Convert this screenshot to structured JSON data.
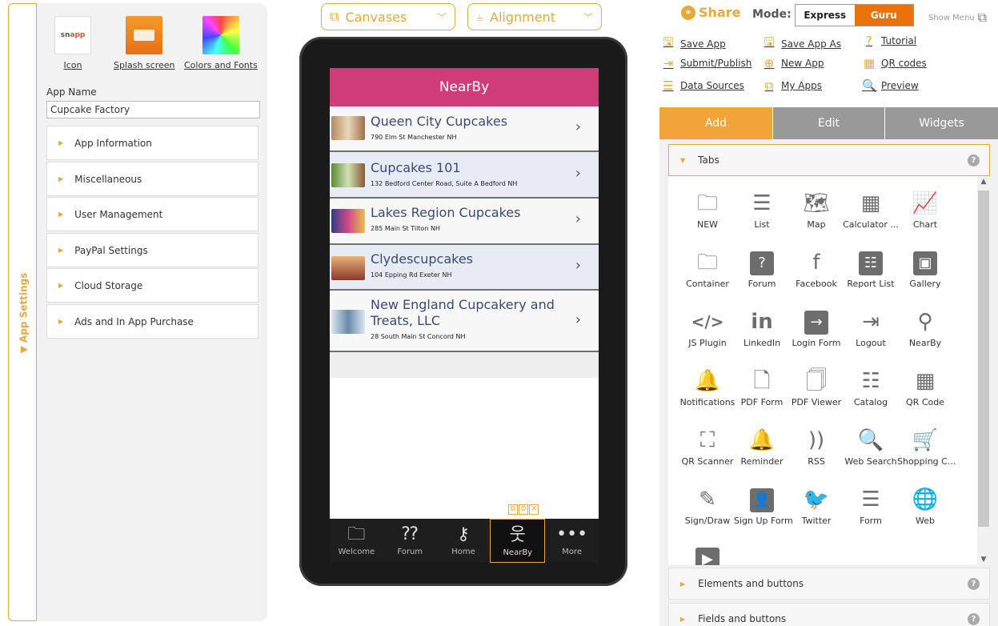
{
  "settings": {
    "tab_label": "▼ App Settings",
    "assets": [
      {
        "label": "Icon",
        "thumb_text": "sn",
        "thumb_accent": "app"
      },
      {
        "label": "Splash screen"
      },
      {
        "label": "Colors and Fonts"
      }
    ],
    "app_name_label": "App Name",
    "app_name_value": "Cupcake Factory",
    "sections": [
      "App Information",
      "Miscellaneous",
      "User Management",
      "PayPal Settings",
      "Cloud Storage",
      "Ads and In App Purchase"
    ]
  },
  "toolbar": {
    "canvases_label": "Canvases",
    "alignment_label": "Alignment"
  },
  "phone": {
    "header_title": "NearBy",
    "locations": [
      {
        "name": "Queen City Cupcakes",
        "address": "790 Elm St Manchester NH"
      },
      {
        "name": "Cupcakes 101",
        "address": "132 Bedford Center Road, Suite A Bedford NH"
      },
      {
        "name": "Lakes Region Cupcakes",
        "address": "285 Main St Tilton NH"
      },
      {
        "name": "Clydescupcakes",
        "address": "104 Epping Rd Exeter NH"
      },
      {
        "name": "New England Cupcakery and Treats, LLC",
        "address": "28 South Main St Concord NH"
      }
    ],
    "tabbar": [
      {
        "label": "Welcome",
        "icon": "folder-icon"
      },
      {
        "label": "Forum",
        "icon": "forum-icon"
      },
      {
        "label": "Home",
        "icon": "key-icon"
      },
      {
        "label": "NearBy",
        "icon": "person-icon",
        "selected": true
      },
      {
        "label": "More",
        "icon": "more-icon"
      }
    ]
  },
  "header": {
    "share_label": "Share",
    "mode_label": "Mode:",
    "mode_express": "Express",
    "mode_guru": "Guru",
    "show_menu": "Show Menu"
  },
  "actions": {
    "save_app": "Save App",
    "save_app_as": "Save App As",
    "tutorial": "Tutorial",
    "submit_publish": "Submit/Publish",
    "new_app": "New App",
    "qr_codes": "QR codes",
    "data_sources": "Data Sources",
    "my_apps": "My Apps",
    "preview": "Preview"
  },
  "panel": {
    "tabs": [
      "Add",
      "Edit",
      "Widgets"
    ],
    "active_tab": "Add",
    "sections": {
      "tabs": "Tabs",
      "elements": "Elements and buttons",
      "fields": "Fields and buttons"
    },
    "widgets": [
      "NEW",
      "List",
      "Map",
      "Calculator ...",
      "Chart",
      "Container",
      "Forum",
      "Facebook",
      "Report List",
      "Gallery",
      "JS Plugin",
      "LinkedIn",
      "Login Form",
      "Logout",
      "NearBy",
      "Notifications",
      "PDF Form",
      "PDF Viewer",
      "Catalog",
      "QR Code",
      "QR Scanner",
      "Reminder",
      "RSS",
      "Web Search",
      "Shopping C...",
      "Sign/Draw",
      "Sign Up Form",
      "Twitter",
      "Form",
      "Web"
    ]
  },
  "colors": {
    "accent": "#e9a83c",
    "guru": "#e8730c",
    "phone_header": "#cf3c78",
    "phone_link": "#3a4a78"
  }
}
